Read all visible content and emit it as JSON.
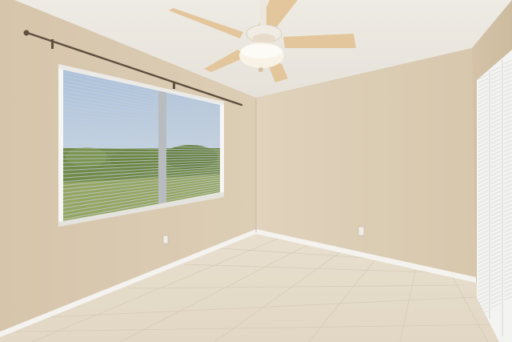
{
  "scene": {
    "description_colors": {
      "ceiling": "#ece9e2",
      "left_wall": "#d9c9b1",
      "back_wall": "#dccdb6",
      "floor": "#e6dccb",
      "baseboard": "#f4f2ee",
      "fan_blade": "#e2c49a",
      "fan_body": "#f2efe8",
      "window_frame": "#f6f6f4",
      "blind": "#cfd3d6",
      "sky": "#b7c9df",
      "grass": "#8fa05e",
      "trees": "#6d8647",
      "curtain_rod": "#6b5a45",
      "closet_door": "#f3f3f1"
    },
    "objects": [
      {
        "name": "ceiling-fan",
        "icon": "ceiling-fan-icon"
      },
      {
        "name": "window-with-blinds",
        "icon": "window-icon"
      },
      {
        "name": "curtain-rod",
        "icon": "rod-icon"
      },
      {
        "name": "louvered-closet-door",
        "icon": "door-icon"
      },
      {
        "name": "electrical-outlet",
        "icon": "outlet-icon"
      },
      {
        "name": "tile-floor",
        "icon": "floor-icon"
      }
    ]
  }
}
